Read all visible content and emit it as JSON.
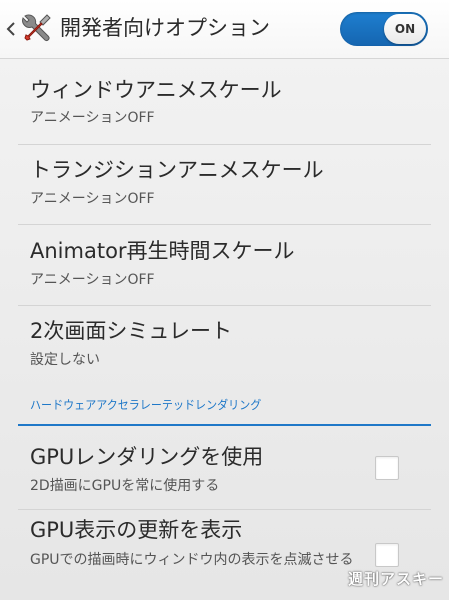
{
  "action_bar": {
    "title": "開発者向けオプション",
    "switch_label": "ON",
    "switch_on": true,
    "accent_color": "#1f78c8"
  },
  "rows": [
    {
      "title": "ウィンドウアニメスケール",
      "summary": "アニメーションOFF"
    },
    {
      "title": "トランジションアニメスケール",
      "summary": "アニメーションOFF"
    },
    {
      "title": "Animator再生時間スケール",
      "summary": "アニメーションOFF"
    },
    {
      "title": "2次画面シミュレート",
      "summary": "設定しない"
    }
  ],
  "section": {
    "header": "ハードウェアアクセラレーテッドレンダリング"
  },
  "check_rows": [
    {
      "title": "GPUレンダリングを使用",
      "summary": "2D描画にGPUを常に使用する",
      "checked": false
    },
    {
      "title": "GPU表示の更新を表示",
      "summary": "GPUでの描画時にウィンドウ内の表示を点滅させる",
      "checked": false
    }
  ],
  "watermark": "週刊アスキー"
}
